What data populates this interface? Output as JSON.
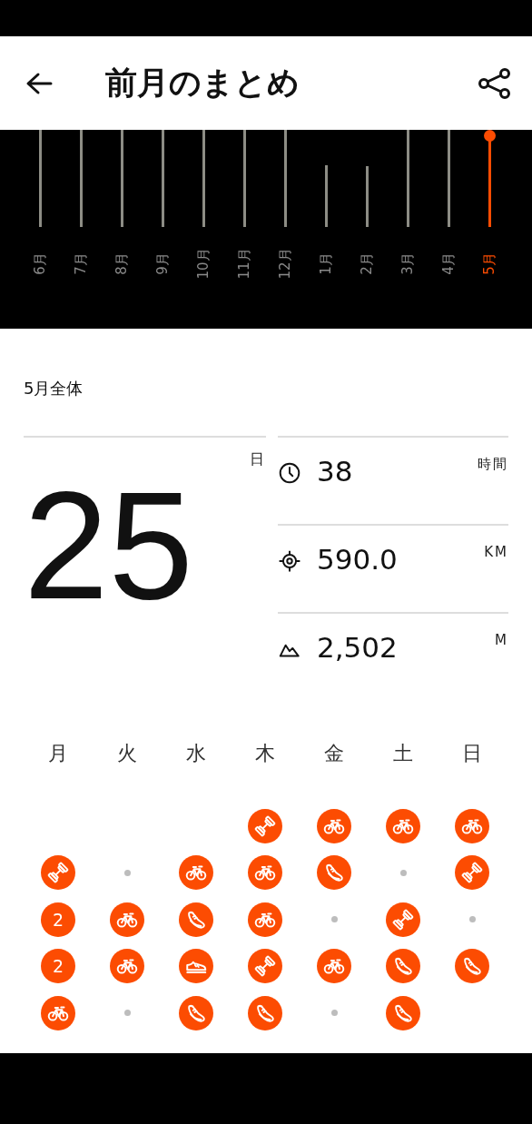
{
  "header": {
    "title": "前月のまとめ"
  },
  "months": [
    {
      "label": "6月",
      "selected": false
    },
    {
      "label": "7月",
      "selected": false
    },
    {
      "label": "8月",
      "selected": false
    },
    {
      "label": "9月",
      "selected": false
    },
    {
      "label": "10月",
      "selected": false
    },
    {
      "label": "11月",
      "selected": false
    },
    {
      "label": "12月",
      "selected": false
    },
    {
      "label": "1月",
      "selected": false
    },
    {
      "label": "2月",
      "selected": false
    },
    {
      "label": "3月",
      "selected": false
    },
    {
      "label": "4月",
      "selected": false
    },
    {
      "label": "5月",
      "selected": true
    }
  ],
  "summary": {
    "title": "5月全体",
    "days": {
      "value": "25",
      "unit": "日"
    },
    "stats": [
      {
        "kind": "time",
        "value": "38",
        "unit": "時間"
      },
      {
        "kind": "distance",
        "value": "590.0",
        "unit": "KM"
      },
      {
        "kind": "elevation",
        "value": "2,502",
        "unit": "M"
      }
    ]
  },
  "weekdays": [
    "月",
    "火",
    "水",
    "木",
    "金",
    "土",
    "日"
  ],
  "days": [
    {
      "kind": "blank"
    },
    {
      "kind": "blank"
    },
    {
      "kind": "blank"
    },
    {
      "kind": "strength"
    },
    {
      "kind": "ride"
    },
    {
      "kind": "ride"
    },
    {
      "kind": "ride"
    },
    {
      "kind": "strength"
    },
    {
      "kind": "rest"
    },
    {
      "kind": "ride"
    },
    {
      "kind": "ride"
    },
    {
      "kind": "run"
    },
    {
      "kind": "rest"
    },
    {
      "kind": "strength"
    },
    {
      "kind": "count",
      "count": "2"
    },
    {
      "kind": "ride"
    },
    {
      "kind": "run"
    },
    {
      "kind": "ride"
    },
    {
      "kind": "rest"
    },
    {
      "kind": "strength"
    },
    {
      "kind": "rest"
    },
    {
      "kind": "count",
      "count": "2"
    },
    {
      "kind": "ride"
    },
    {
      "kind": "walk"
    },
    {
      "kind": "strength"
    },
    {
      "kind": "ride"
    },
    {
      "kind": "run"
    },
    {
      "kind": "run"
    },
    {
      "kind": "ride"
    },
    {
      "kind": "rest"
    },
    {
      "kind": "run"
    },
    {
      "kind": "run"
    },
    {
      "kind": "rest"
    },
    {
      "kind": "run"
    },
    {
      "kind": "blank"
    }
  ]
}
